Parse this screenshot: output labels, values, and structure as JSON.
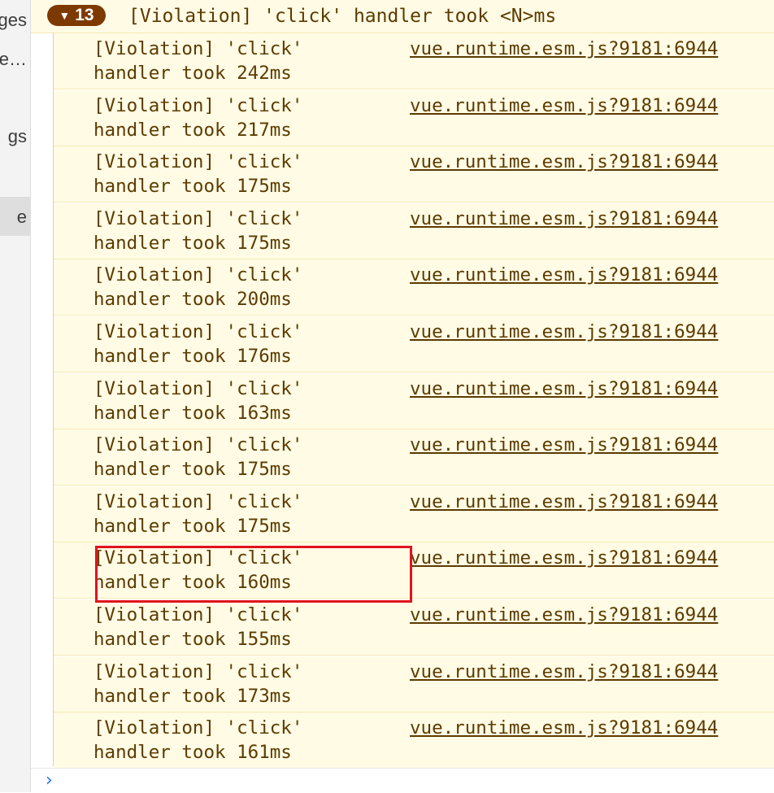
{
  "sidebar": {
    "items": [
      {
        "label": "ges"
      },
      {
        "label": "e…"
      },
      {
        "label": "gs"
      },
      {
        "label": "e"
      }
    ]
  },
  "console": {
    "group": {
      "count": "13",
      "title": "[Violation] 'click' handler took <N>ms"
    },
    "messages": [
      {
        "line1": "[Violation] 'click'",
        "line2": "handler took 242ms",
        "source": "vue.runtime.esm.js?9181:6944"
      },
      {
        "line1": "[Violation] 'click'",
        "line2": "handler took 217ms",
        "source": "vue.runtime.esm.js?9181:6944"
      },
      {
        "line1": "[Violation] 'click'",
        "line2": "handler took 175ms",
        "source": "vue.runtime.esm.js?9181:6944"
      },
      {
        "line1": "[Violation] 'click'",
        "line2": "handler took 175ms",
        "source": "vue.runtime.esm.js?9181:6944"
      },
      {
        "line1": "[Violation] 'click'",
        "line2": "handler took 200ms",
        "source": "vue.runtime.esm.js?9181:6944"
      },
      {
        "line1": "[Violation] 'click'",
        "line2": "handler took 176ms",
        "source": "vue.runtime.esm.js?9181:6944"
      },
      {
        "line1": "[Violation] 'click'",
        "line2": "handler took 163ms",
        "source": "vue.runtime.esm.js?9181:6944"
      },
      {
        "line1": "[Violation] 'click'",
        "line2": "handler took 175ms",
        "source": "vue.runtime.esm.js?9181:6944"
      },
      {
        "line1": "[Violation] 'click'",
        "line2": "handler took 175ms",
        "source": "vue.runtime.esm.js?9181:6944"
      },
      {
        "line1": "[Violation] 'click'",
        "line2": "handler took 160ms",
        "source": "vue.runtime.esm.js?9181:6944"
      },
      {
        "line1": "[Violation] 'click'",
        "line2": "handler took 155ms",
        "source": "vue.runtime.esm.js?9181:6944"
      },
      {
        "line1": "[Violation] 'click'",
        "line2": "handler took 173ms",
        "source": "vue.runtime.esm.js?9181:6944"
      },
      {
        "line1": "[Violation] 'click'",
        "line2": "handler took 161ms",
        "source": "vue.runtime.esm.js?9181:6944"
      }
    ],
    "prompt_icon": "chevron-right-icon"
  },
  "colors": {
    "warning_bg": "#fffbe5",
    "warning_text": "#5c3b00",
    "badge_bg": "#7d3a00",
    "highlight": "#e0141e",
    "prompt": "#1a73e8"
  }
}
